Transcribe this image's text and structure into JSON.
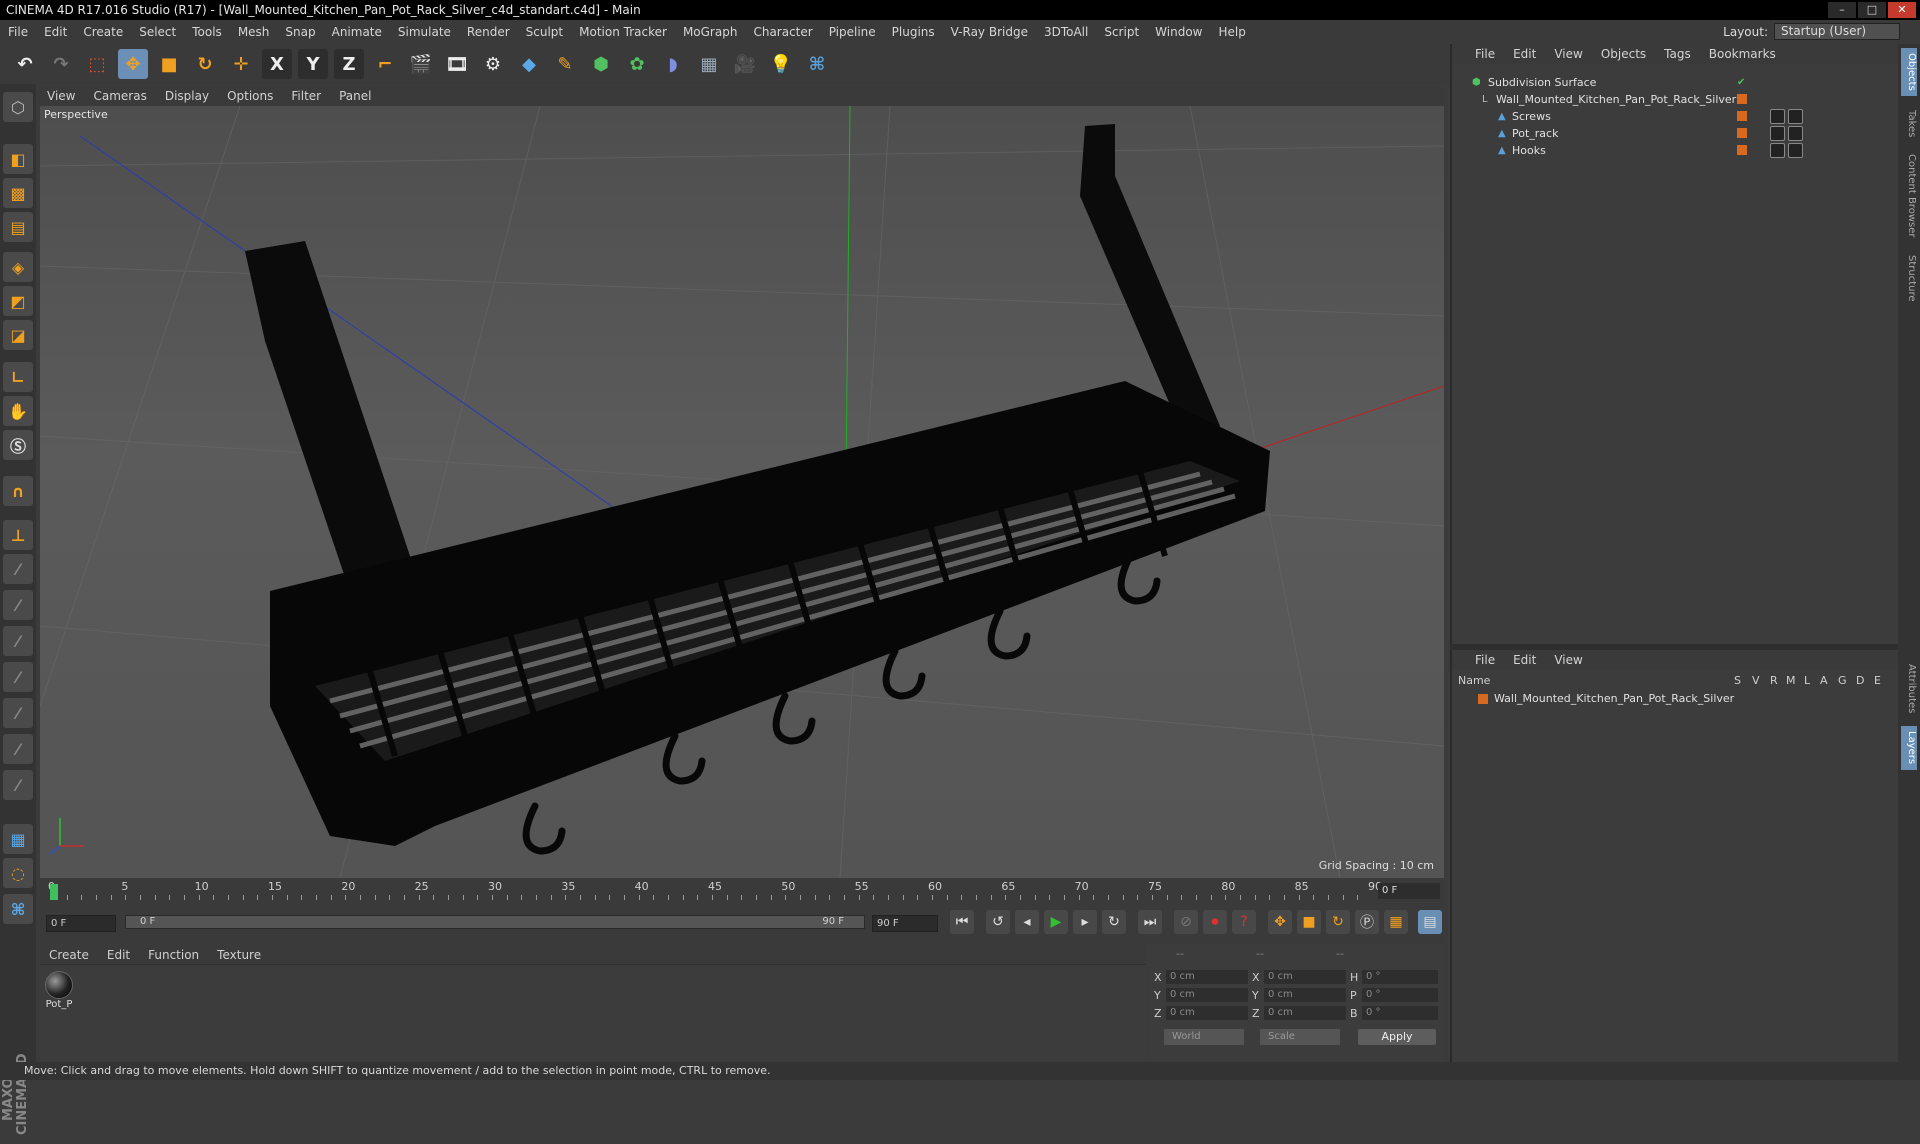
{
  "window": {
    "title": "CINEMA 4D R17.016 Studio (R17) - [Wall_Mounted_Kitchen_Pan_Pot_Rack_Silver_c4d_standart.c4d] - Main"
  },
  "menu": [
    "File",
    "Edit",
    "Create",
    "Select",
    "Tools",
    "Mesh",
    "Snap",
    "Animate",
    "Simulate",
    "Render",
    "Sculpt",
    "Motion Tracker",
    "MoGraph",
    "Character",
    "Pipeline",
    "Plugins",
    "V-Ray Bridge",
    "3DToAll",
    "Script",
    "Window",
    "Help"
  ],
  "layout": {
    "label": "Layout:",
    "value": "Startup (User)"
  },
  "toolbar": {
    "x": "X",
    "y": "Y",
    "z": "Z"
  },
  "viewport": {
    "menu": [
      "View",
      "Cameras",
      "Display",
      "Options",
      "Filter",
      "Panel"
    ],
    "label": "Perspective",
    "grid_spacing": "Grid Spacing : 10 cm"
  },
  "timeline": {
    "ticks": [
      "0",
      "5",
      "10",
      "15",
      "20",
      "25",
      "30",
      "35",
      "40",
      "45",
      "50",
      "55",
      "60",
      "65",
      "70",
      "75",
      "80",
      "85",
      "90"
    ],
    "current": "0 F"
  },
  "transport": {
    "start": "0 F",
    "slider_start": "0 F",
    "slider_end": "90 F",
    "end": "90 F"
  },
  "materials": {
    "menu": [
      "Create",
      "Edit",
      "Function",
      "Texture"
    ],
    "items": [
      {
        "name": "Pot_P"
      }
    ]
  },
  "coords": {
    "headers": [
      "--",
      "--",
      "--"
    ],
    "rows": [
      {
        "a": "X",
        "av": "0 cm",
        "b": "X",
        "bv": "0 cm",
        "c": "H",
        "cv": "0 °"
      },
      {
        "a": "Y",
        "av": "0 cm",
        "b": "Y",
        "bv": "0 cm",
        "c": "P",
        "cv": "0 °"
      },
      {
        "a": "Z",
        "av": "0 cm",
        "b": "Z",
        "bv": "0 cm",
        "c": "B",
        "cv": "0 °"
      }
    ],
    "space": "World",
    "mode": "Scale",
    "apply": "Apply"
  },
  "objects": {
    "menu": [
      "File",
      "Edit",
      "View",
      "Objects",
      "Tags",
      "Bookmarks"
    ],
    "items": [
      {
        "name": "Subdivision Surface"
      },
      {
        "name": "Wall_Mounted_Kitchen_Pan_Pot_Rack_Silver"
      },
      {
        "name": "Screws"
      },
      {
        "name": "Pot_rack"
      },
      {
        "name": "Hooks"
      }
    ]
  },
  "layers": {
    "menu": [
      "File",
      "Edit",
      "View"
    ],
    "columns": [
      "Name",
      "S",
      "V",
      "R",
      "M",
      "L",
      "A",
      "G",
      "D",
      "E"
    ],
    "items": [
      {
        "name": "Wall_Mounted_Kitchen_Pan_Pot_Rack_Silver"
      }
    ]
  },
  "side_tabs": [
    "Objects",
    "Takes",
    "Content Browser",
    "Structure",
    "Attributes",
    "Layers"
  ],
  "status": "Move: Click and drag to move elements. Hold down SHIFT to quantize movement / add to the selection in point mode, CTRL to remove."
}
